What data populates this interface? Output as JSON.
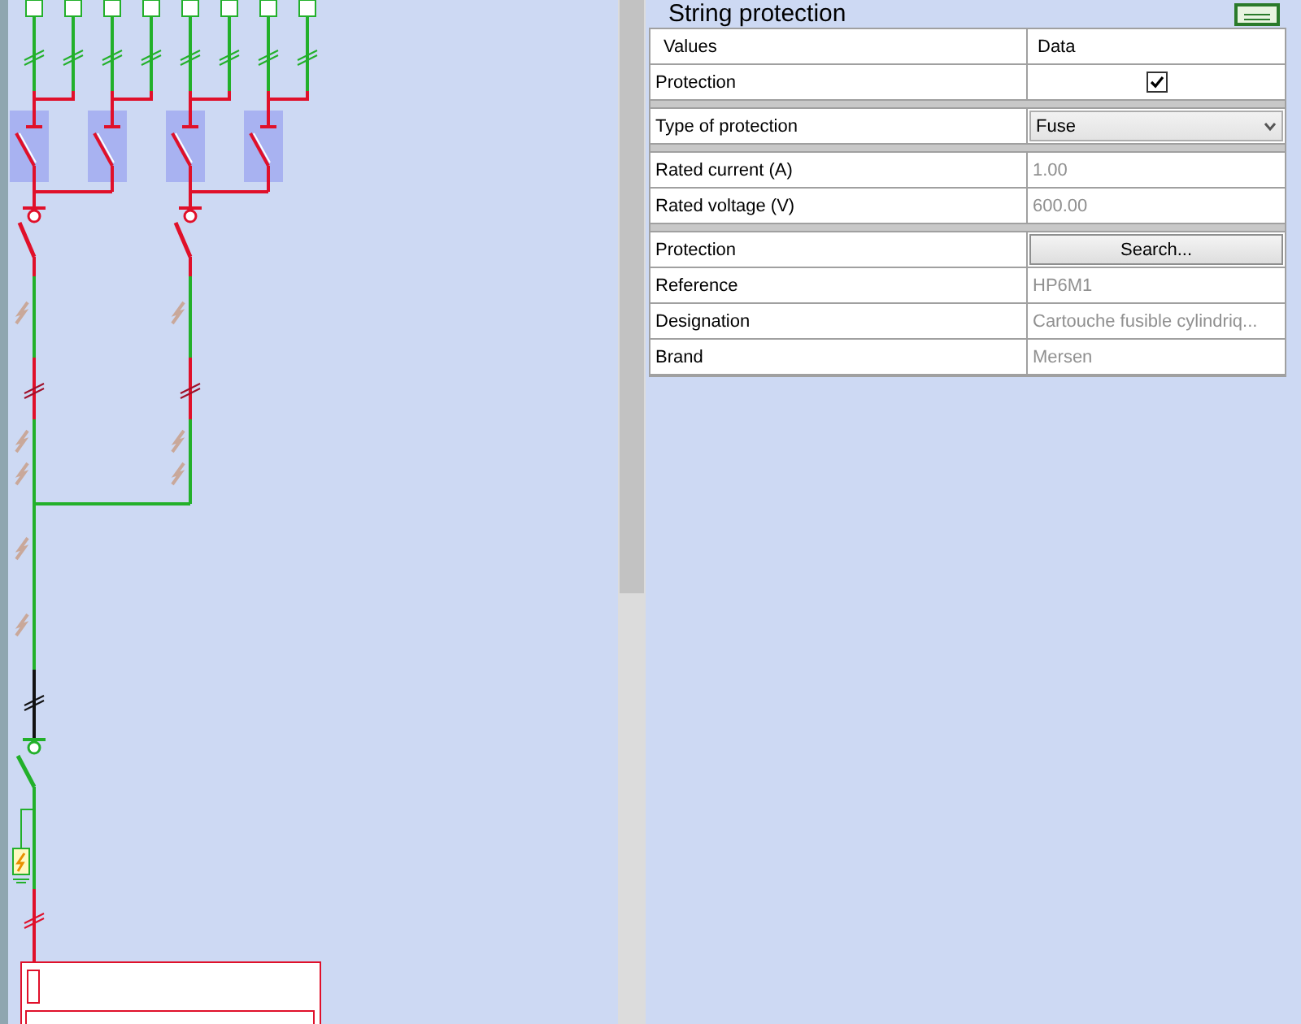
{
  "panel": {
    "title": "String protection"
  },
  "table": {
    "columns": [
      "Values",
      "Data"
    ],
    "groups": [
      {
        "rows": [
          {
            "kind": "checkbox",
            "label": "Protection",
            "checked": true
          }
        ]
      },
      {
        "rows": [
          {
            "kind": "select",
            "label": "Type of protection",
            "value": "Fuse"
          }
        ]
      },
      {
        "rows": [
          {
            "kind": "text",
            "label": "Rated current (A)",
            "value": "1.00",
            "readonly": true
          },
          {
            "kind": "text",
            "label": "Rated voltage (V)",
            "value": "600.00",
            "readonly": true
          }
        ]
      },
      {
        "rows": [
          {
            "kind": "button",
            "label": "Protection",
            "value": "Search..."
          },
          {
            "kind": "text",
            "label": "Reference",
            "value": "HP6M1",
            "readonly": true
          },
          {
            "kind": "text",
            "label": "Designation",
            "value": "Cartouche fusible cylindriq...",
            "readonly": true
          },
          {
            "kind": "text",
            "label": "Brand",
            "value": "Mersen",
            "readonly": true
          }
        ]
      }
    ]
  }
}
